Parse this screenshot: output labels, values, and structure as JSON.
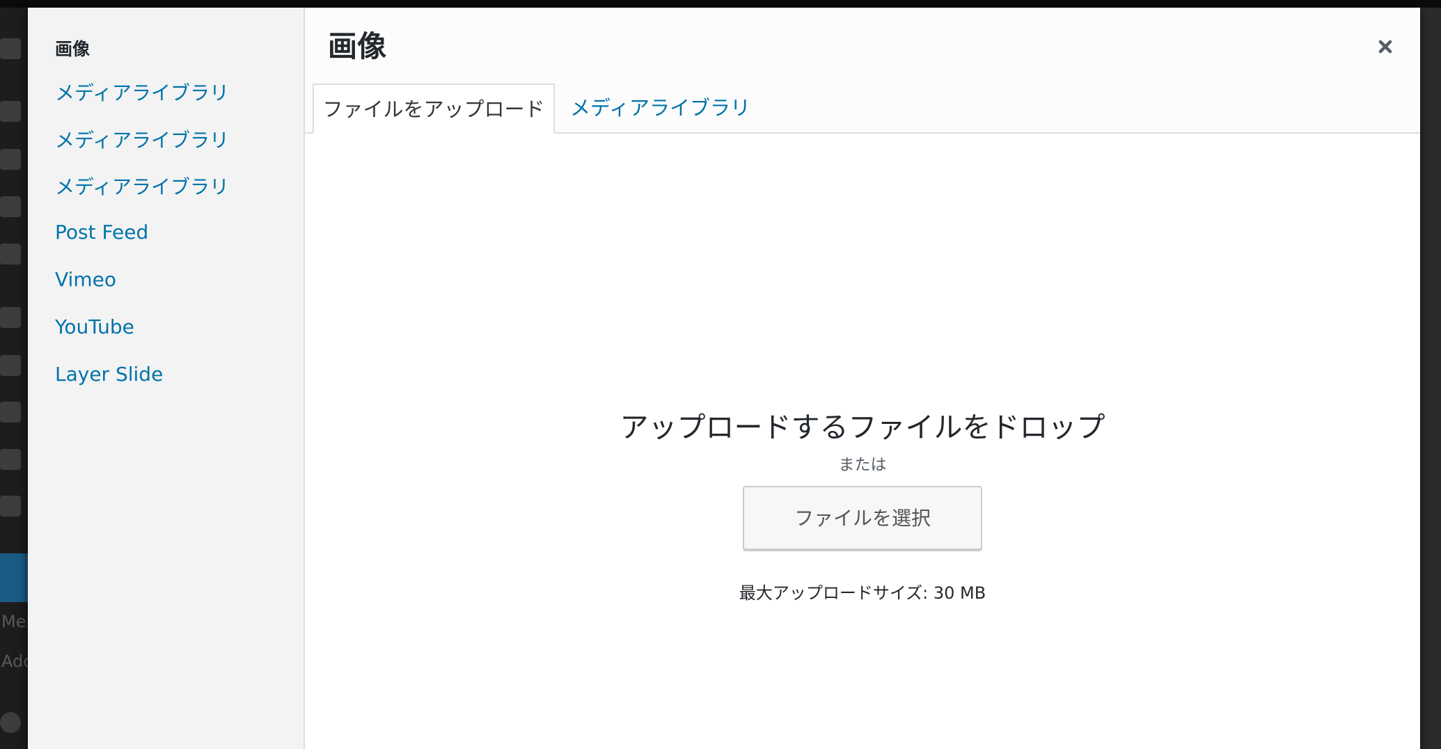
{
  "modal": {
    "title": "画像",
    "close_icon": "close-icon"
  },
  "menu": {
    "heading": "画像",
    "items": [
      {
        "label": "メディアライブラリ"
      },
      {
        "label": "メディアライブラリ"
      },
      {
        "label": "メディアライブラリ"
      },
      {
        "label": "Post Feed"
      },
      {
        "label": "Vimeo"
      },
      {
        "label": "YouTube"
      },
      {
        "label": "Layer Slide"
      }
    ]
  },
  "tabs": [
    {
      "label": "ファイルをアップロード",
      "active": true
    },
    {
      "label": "メディアライブラリ",
      "active": false
    }
  ],
  "uploader": {
    "drop_instructions": "アップロードするファイルをドロップ",
    "or_text": "または",
    "select_button": "ファイルを選択",
    "max_size": "最大アップロードサイズ: 30 MB"
  },
  "background_admin": {
    "menu_text_partial_1": "Me",
    "menu_text_partial_2": "Ado"
  },
  "colors": {
    "link": "#0073aa",
    "menu_bg": "#f3f3f3",
    "admin_bar": "#1d1d1d",
    "active_admin_item": "#1a5b86"
  }
}
